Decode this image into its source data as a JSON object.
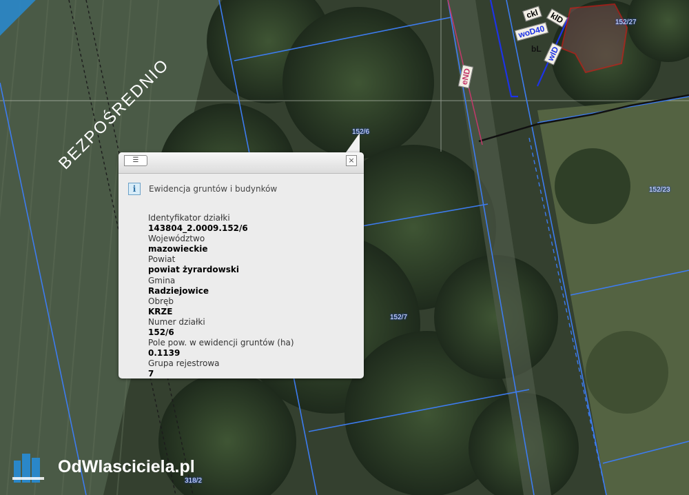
{
  "parcel_labels": [
    "152/6",
    "152/7",
    "152/27",
    "152/23",
    "318/2"
  ],
  "utility_labels": [
    "ckl",
    "klD",
    "woD40",
    "wlD",
    "bL",
    "eND"
  ],
  "banner": {
    "text": "BEZPOŚREDNIO",
    "color": "#2a87c8"
  },
  "popup": {
    "title": "Ewidencja gruntów i budynków",
    "info_icon": "info-icon",
    "back_icon": "list-back-icon",
    "close_icon": "close-icon",
    "fields": [
      {
        "label": "Identyfikator działki",
        "value": "143804_2.0009.152/6"
      },
      {
        "label": "Województwo",
        "value": "mazowieckie"
      },
      {
        "label": "Powiat",
        "value": "powiat żyrardowski"
      },
      {
        "label": "Gmina",
        "value": "Radziejowice"
      },
      {
        "label": "Obręb",
        "value": "KRZE"
      },
      {
        "label": "Numer działki",
        "value": "152/6"
      },
      {
        "label": "Pole pow. w ewidencji gruntów (ha)",
        "value": "0.1139"
      },
      {
        "label": "Grupa rejestrowa",
        "value": "7"
      }
    ]
  },
  "brand": {
    "name": "OdWlasciciela.pl",
    "logo_icon": "buildings-logo-icon"
  }
}
